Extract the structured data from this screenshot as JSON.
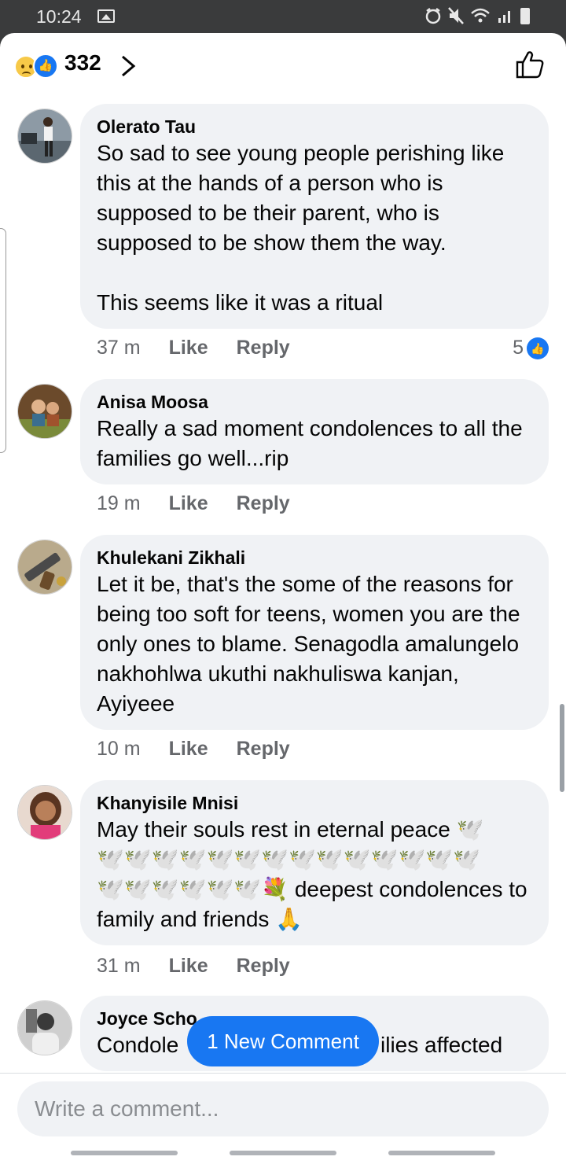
{
  "status_bar": {
    "time": "10:24"
  },
  "header": {
    "reaction_count": "332",
    "reaction_types": [
      "sad",
      "like"
    ]
  },
  "comments": [
    {
      "name": "Olerato Tau",
      "text": "So sad to see young people perishing like this at the hands of a person who is supposed to be their parent, who is supposed to be show them the way.\n\nThis seems like it was a ritual",
      "time": "37 m",
      "like_label": "Like",
      "reply_label": "Reply",
      "reactions": "5"
    },
    {
      "name": "Anisa Moosa",
      "text": "Really a sad moment condolences to all the families go well...rip",
      "time": "19 m",
      "like_label": "Like",
      "reply_label": "Reply"
    },
    {
      "name": "Khulekani Zikhali",
      "text": "Let it be, that's the some of the reasons for being too soft for teens, women you are the only ones to blame. Senagodla amalungelo nakhohlwa ukuthi nakhuliswa kanjan, Ayiyeee",
      "time": "10 m",
      "like_label": "Like",
      "reply_label": "Reply"
    },
    {
      "name": "Khanyisile Mnisi",
      "text": "May their souls rest in eternal peace 🕊️\n🕊️🕊️🕊️🕊️🕊️🕊️🕊️🕊️🕊️🕊️🕊️🕊️🕊️🕊️\n🕊️🕊️🕊️🕊️🕊️🕊️💐 deepest condolences to family and friends 🙏",
      "time": "31 m",
      "like_label": "Like",
      "reply_label": "Reply"
    },
    {
      "name": "Joyce Scho",
      "text": "Condole                                 ilies affected"
    }
  ],
  "new_comment_label": "1 New Comment",
  "composer": {
    "placeholder": "Write a comment..."
  },
  "colors": {
    "accent": "#1877f2",
    "bubble": "#f0f2f5",
    "meta": "#65676b"
  }
}
